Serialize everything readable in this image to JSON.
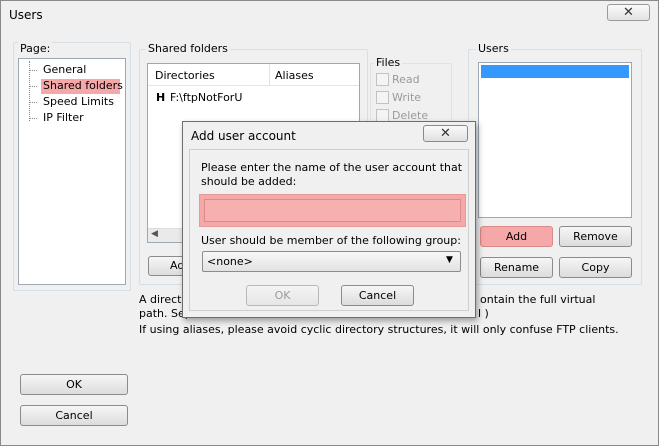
{
  "window": {
    "title": "Users",
    "close_glyph": "✕"
  },
  "page_panel": {
    "label": "Page:",
    "items": [
      "General",
      "Shared folders",
      "Speed Limits",
      "IP Filter"
    ]
  },
  "shared": {
    "label": "Shared folders",
    "columns": [
      "Directories",
      "Aliases"
    ],
    "rows": [
      {
        "marker": "H",
        "path": "F:\\ftpNotForU"
      }
    ],
    "add_button_partial": "Ad"
  },
  "files": {
    "label": "Files",
    "options": [
      "Read",
      "Write",
      "Delete"
    ]
  },
  "users": {
    "label": "Users",
    "buttons": {
      "add": "Add",
      "remove": "Remove",
      "rename": "Rename",
      "copy": "Copy"
    }
  },
  "info": {
    "line1_left": "A directo",
    "line1_right": "ontain the full virtual",
    "line2_left": "path. Sep",
    "line2_right": "l )",
    "line3": "If using aliases, please avoid cyclic directory structures, it will only confuse FTP clients."
  },
  "footer": {
    "ok": "OK",
    "cancel": "Cancel"
  },
  "dialog": {
    "title": "Add user account",
    "close_glyph": "✕",
    "prompt": "Please enter the name of the user account that should be added:",
    "name_value": "",
    "group_label": "User should be member of the following group:",
    "group_selected": "<none>",
    "ok": "OK",
    "cancel": "Cancel"
  },
  "colors": {
    "highlight": "#f6a8a8",
    "selection": "#3399ff"
  }
}
